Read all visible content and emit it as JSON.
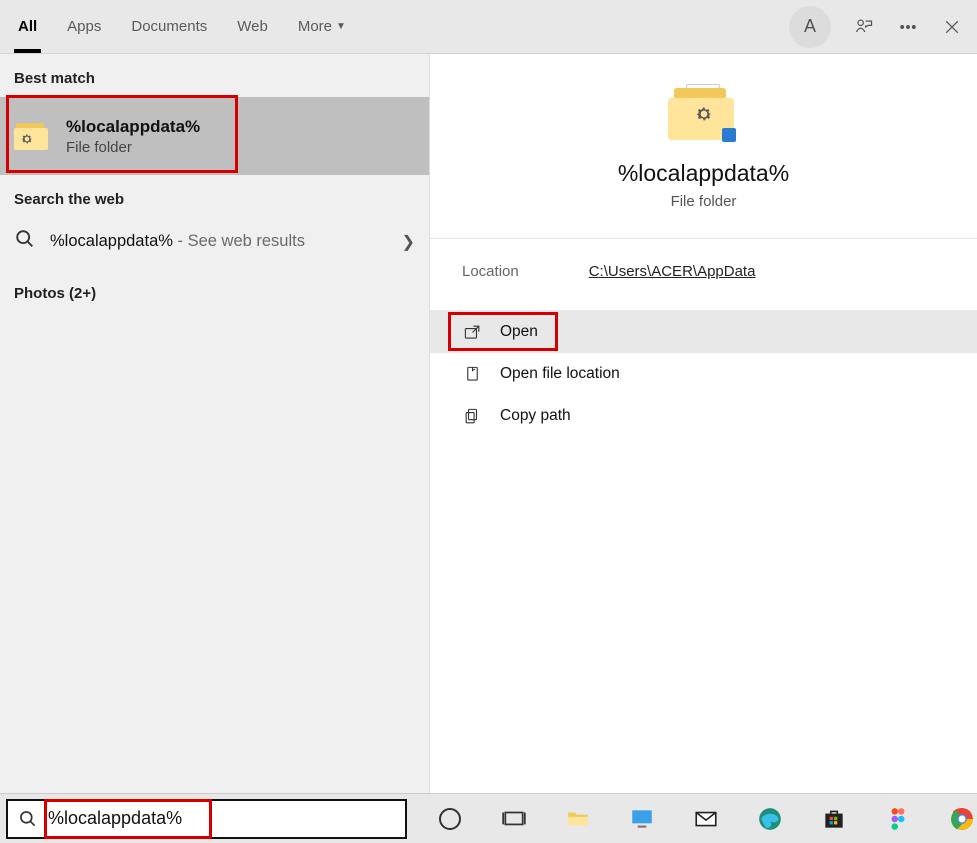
{
  "header": {
    "tabs": {
      "all": "All",
      "apps": "Apps",
      "documents": "Documents",
      "web": "Web",
      "more": "More"
    },
    "avatar_initial": "A"
  },
  "left": {
    "best_match_label": "Best match",
    "best_match": {
      "title": "%localappdata%",
      "subtitle": "File folder"
    },
    "search_web_label": "Search the web",
    "web_result": {
      "query": "%localappdata%",
      "suffix": " - See web results"
    },
    "photos_label": "Photos (2+)"
  },
  "preview": {
    "title": "%localappdata%",
    "subtitle": "File folder",
    "location_label": "Location",
    "location_value": "C:\\Users\\ACER\\AppData",
    "actions": {
      "open": "Open",
      "open_file_location": "Open file location",
      "copy_path": "Copy path"
    }
  },
  "taskbar": {
    "search_value": "%localappdata%"
  }
}
